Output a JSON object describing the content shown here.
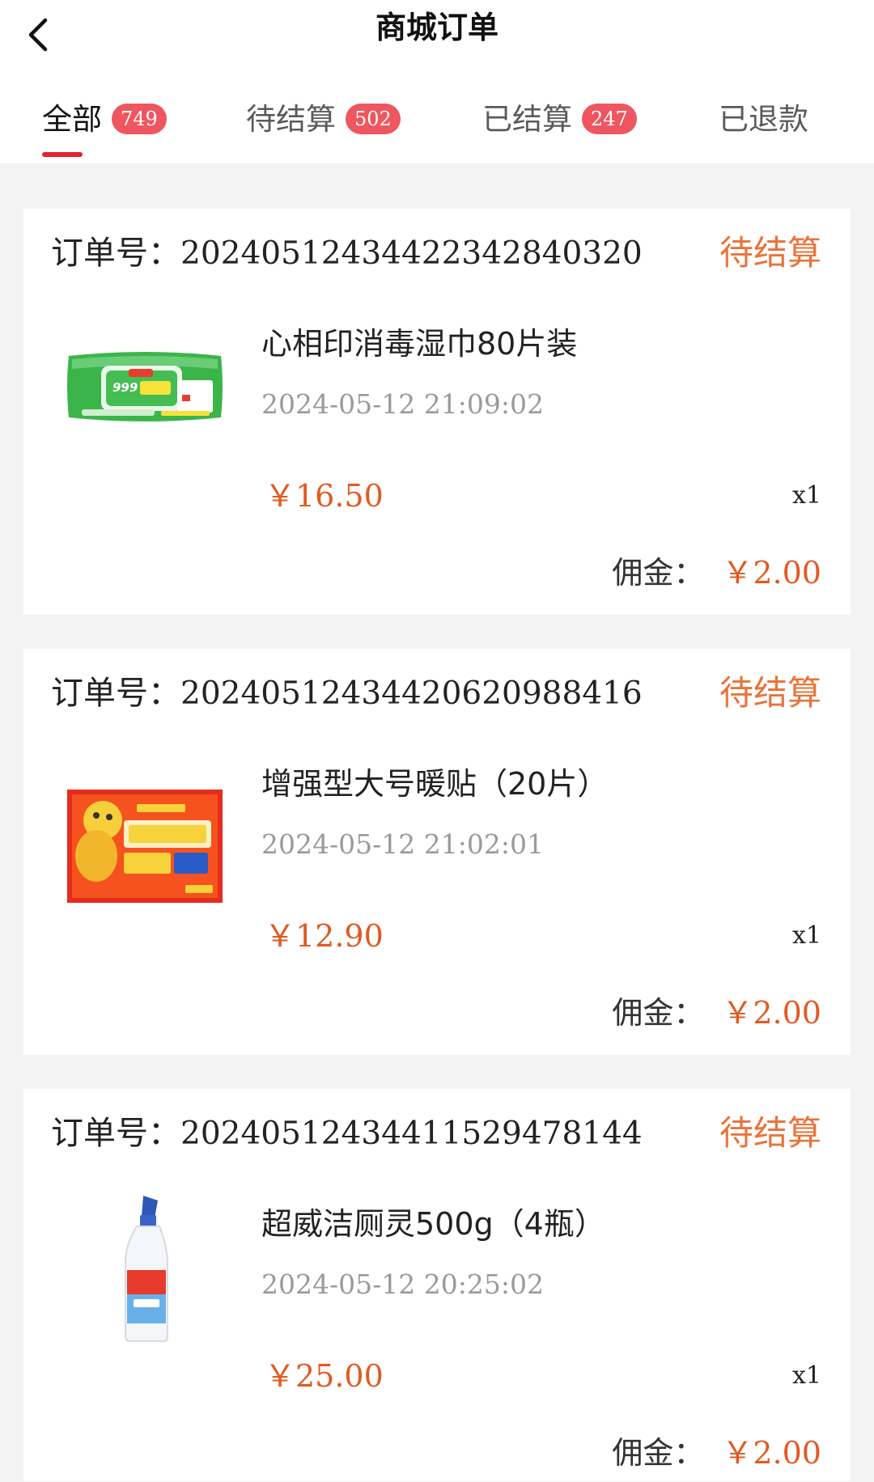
{
  "header": {
    "title": "商城订单",
    "back_icon": "chevron-left-icon"
  },
  "tabs": [
    {
      "label": "全部",
      "count": "749",
      "active": true
    },
    {
      "label": "待结算",
      "count": "502",
      "active": false
    },
    {
      "label": "已结算",
      "count": "247",
      "active": false
    },
    {
      "label": "已退款",
      "count": "",
      "active": false
    }
  ],
  "colors": {
    "accent_red": "#e0232f",
    "badge_red": "#ee5660",
    "status_orange": "#e8743b",
    "price_orange": "#e05a22"
  },
  "order_labels": {
    "order_number": "订单号：",
    "commission": "佣金："
  },
  "orders": [
    {
      "order_number": "202405124344223428403​20",
      "status": "待结算",
      "product_name": "心相印消毒湿巾80片装",
      "time": "2024-05-12 21:09:02",
      "price": "￥16.50",
      "quantity": "x1",
      "commission": "￥2.00",
      "image": "wet-wipes-pack-image"
    },
    {
      "order_number": "20240512434420620988416",
      "status": "待结算",
      "product_name": "增强型大号暖贴（20片）",
      "time": "2024-05-12 21:02:01",
      "price": "￥12.90",
      "quantity": "x1",
      "commission": "￥2.00",
      "image": "heat-patch-box-image"
    },
    {
      "order_number": "20240512434411529478144",
      "status": "待结算",
      "product_name": "超威洁厕灵500g（4瓶）",
      "time": "2024-05-12 20:25:02",
      "price": "￥25.00",
      "quantity": "x1",
      "commission": "￥2.00",
      "image": "toilet-cleaner-bottle-image"
    }
  ]
}
